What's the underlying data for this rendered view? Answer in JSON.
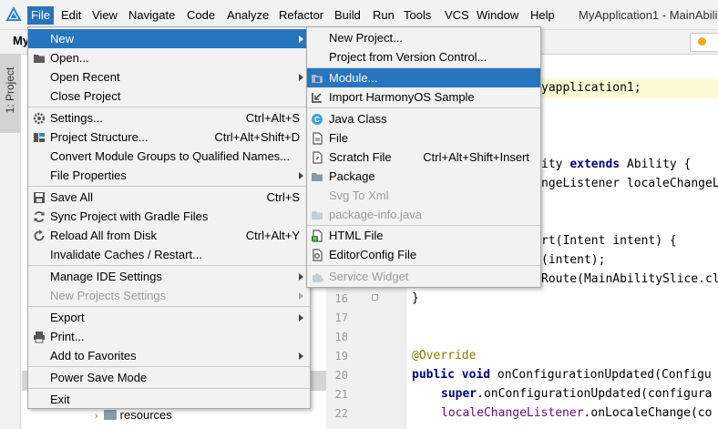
{
  "menubar": {
    "logo_icon": "harmonyos-logo-icon",
    "items": [
      "File",
      "Edit",
      "View",
      "Navigate",
      "Code",
      "Analyze",
      "Refactor",
      "Build",
      "Run",
      "Tools",
      "VCS",
      "Window",
      "Help"
    ],
    "active": "File",
    "window_title": "MyApplication1 - MainAbili"
  },
  "toolbar": {
    "project_crumb": "My"
  },
  "tool_window": {
    "project_label": "1: Project"
  },
  "tree": {
    "resources_label": "resources"
  },
  "file_menu": {
    "items": [
      {
        "label": "New",
        "shortcut": "",
        "submenu": true,
        "highlight": true,
        "icon": ""
      },
      {
        "label": "Open...",
        "shortcut": "",
        "icon": "folder-icon"
      },
      {
        "label": "Open Recent",
        "shortcut": "",
        "submenu": true,
        "icon": ""
      },
      {
        "label": "Close Project",
        "shortcut": "",
        "icon": ""
      },
      {
        "label": "Settings...",
        "shortcut": "Ctrl+Alt+S",
        "icon": "gear-icon"
      },
      {
        "label": "Project Structure...",
        "shortcut": "Ctrl+Alt+Shift+D",
        "icon": "project-structure-icon"
      },
      {
        "label": "Convert Module Groups to Qualified Names...",
        "shortcut": "",
        "icon": ""
      },
      {
        "label": "File Properties",
        "shortcut": "",
        "submenu": true,
        "icon": ""
      },
      {
        "label": "Save All",
        "shortcut": "Ctrl+S",
        "icon": "save-icon"
      },
      {
        "label": "Sync Project with Gradle Files",
        "shortcut": "",
        "icon": "sync-icon"
      },
      {
        "label": "Reload All from Disk",
        "shortcut": "Ctrl+Alt+Y",
        "icon": "reload-icon"
      },
      {
        "label": "Invalidate Caches / Restart...",
        "shortcut": "",
        "icon": ""
      },
      {
        "label": "Manage IDE Settings",
        "shortcut": "",
        "submenu": true,
        "icon": ""
      },
      {
        "label": "New Projects Settings",
        "shortcut": "",
        "submenu": true,
        "disabled": true,
        "icon": ""
      },
      {
        "label": "Export",
        "shortcut": "",
        "submenu": true,
        "icon": ""
      },
      {
        "label": "Print...",
        "shortcut": "",
        "icon": "print-icon"
      },
      {
        "label": "Add to Favorites",
        "shortcut": "",
        "submenu": true,
        "icon": ""
      },
      {
        "label": "Power Save Mode",
        "shortcut": "",
        "icon": ""
      },
      {
        "label": "Exit",
        "shortcut": "",
        "icon": ""
      }
    ]
  },
  "new_submenu": {
    "items": [
      {
        "label": "New Project...",
        "shortcut": "",
        "icon": ""
      },
      {
        "label": "Project from Version Control...",
        "shortcut": "",
        "icon": ""
      },
      {
        "label": "Module...",
        "shortcut": "",
        "highlight": true,
        "icon": "module-icon"
      },
      {
        "label": "Import HarmonyOS Sample",
        "shortcut": "",
        "icon": "import-icon"
      },
      {
        "label": "Java Class",
        "shortcut": "",
        "icon": "java-class-icon"
      },
      {
        "label": "File",
        "shortcut": "",
        "icon": "file-icon"
      },
      {
        "label": "Scratch File",
        "shortcut": "Ctrl+Alt+Shift+Insert",
        "icon": "scratch-file-icon"
      },
      {
        "label": "Package",
        "shortcut": "",
        "icon": "package-icon"
      },
      {
        "label": "Svg To Xml",
        "shortcut": "",
        "disabled": true,
        "icon": ""
      },
      {
        "label": "package-info.java",
        "shortcut": "",
        "disabled": true,
        "icon": "package-info-icon"
      },
      {
        "label": "HTML File",
        "shortcut": "",
        "icon": "html-file-icon"
      },
      {
        "label": "EditorConfig File",
        "shortcut": "",
        "icon": "editorconfig-icon"
      },
      {
        "label": "Service Widget",
        "shortcut": "",
        "disabled": true,
        "icon": "service-widget-icon"
      }
    ]
  },
  "gutter": {
    "line_numbers": [
      "16",
      "17",
      "18",
      "19",
      "20",
      "21",
      "22"
    ]
  },
  "editor": {
    "lines": {
      "l1": "yapplication1;",
      "l2a": "ity ",
      "l2b": "extends",
      "l2c": " Ability {",
      "l3": "ngeListener localeChangeL",
      "l4": "rt(Intent intent) {",
      "l5": "(intent);",
      "l6": "Route(MainAbilitySlice.cl",
      "l7": "}",
      "l8": "@Override",
      "l9a": "public",
      "l9b": " ",
      "l9c": "void",
      "l9d": " onConfigurationUpdated(Configu",
      "l10a": "super",
      "l10b": ".onConfigurationUpdated(configura",
      "l11a": "localeChangeListener",
      "l11b": ".onLocaleChange(co"
    }
  },
  "colors": {
    "accent": "#2675bf",
    "menu_bg": "#f2f2f2",
    "disabled": "#9a9a9a"
  }
}
